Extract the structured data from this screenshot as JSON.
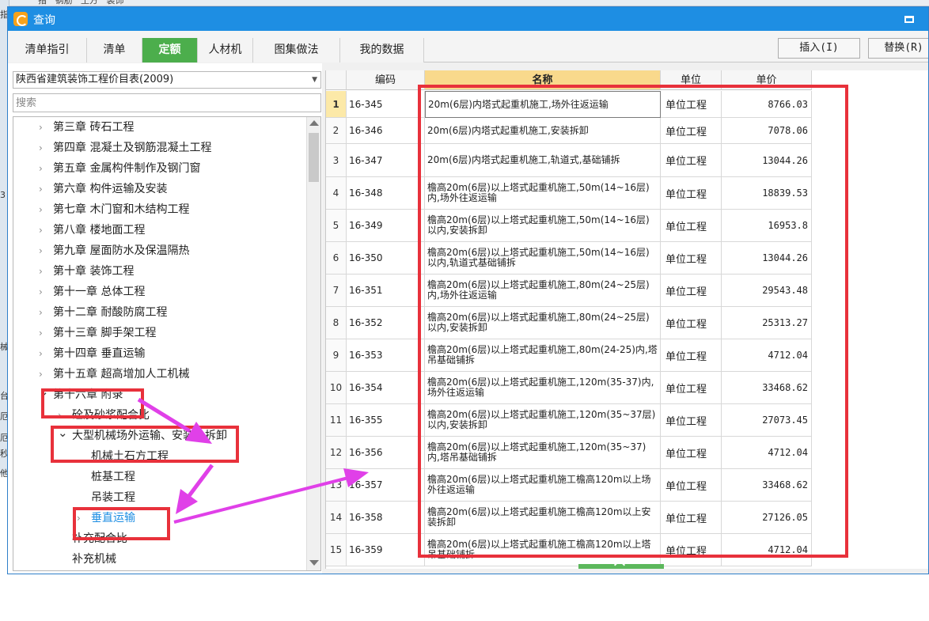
{
  "background": {
    "left_fragments": [
      "指",
      "3",
      "械",
      "台",
      "厄",
      "厄",
      "秒",
      "他"
    ],
    "top_fragment": "指   钢筋   土方   装饰"
  },
  "window": {
    "title": "查询"
  },
  "tabs": [
    {
      "label": "清单指引",
      "active": false
    },
    {
      "label": "清单",
      "active": false
    },
    {
      "label": "定额",
      "active": true
    },
    {
      "label": "人材机",
      "active": false
    },
    {
      "label": "图集做法",
      "active": false
    },
    {
      "label": "我的数据",
      "active": false
    }
  ],
  "buttons": {
    "insert": "插入(I)",
    "replace": "替换(R)"
  },
  "library": {
    "selected": "陕西省建筑装饰工程价目表(2009)"
  },
  "search": {
    "placeholder": "搜索"
  },
  "tree": [
    {
      "label": "第三章 砖石工程",
      "level": 1,
      "toggle": "collapsed"
    },
    {
      "label": "第四章 混凝土及钢筋混凝土工程",
      "level": 1,
      "toggle": "collapsed"
    },
    {
      "label": "第五章 金属构件制作及钢门窗",
      "level": 1,
      "toggle": "collapsed"
    },
    {
      "label": "第六章 构件运输及安装",
      "level": 1,
      "toggle": "collapsed"
    },
    {
      "label": "第七章 木门窗和木结构工程",
      "level": 1,
      "toggle": "collapsed"
    },
    {
      "label": "第八章 楼地面工程",
      "level": 1,
      "toggle": "collapsed"
    },
    {
      "label": "第九章 屋面防水及保温隔热",
      "level": 1,
      "toggle": "collapsed"
    },
    {
      "label": "第十章 装饰工程",
      "level": 1,
      "toggle": "collapsed"
    },
    {
      "label": "第十一章 总体工程",
      "level": 1,
      "toggle": "collapsed"
    },
    {
      "label": "第十二章 耐酸防腐工程",
      "level": 1,
      "toggle": "collapsed"
    },
    {
      "label": "第十三章 脚手架工程",
      "level": 1,
      "toggle": "collapsed"
    },
    {
      "label": "第十四章 垂直运输",
      "level": 1,
      "toggle": "collapsed"
    },
    {
      "label": "第十五章 超高增加人工机械",
      "level": 1,
      "toggle": "collapsed"
    },
    {
      "label": "第十六章 附录",
      "level": 1,
      "toggle": "expanded"
    },
    {
      "label": "砼及砂浆配合比",
      "level": 2,
      "toggle": "collapsed"
    },
    {
      "label": "大型机械场外运输、安装、拆卸",
      "level": 2,
      "toggle": "expanded"
    },
    {
      "label": "机械土石方工程",
      "level": 3,
      "toggle": "none"
    },
    {
      "label": "桩基工程",
      "level": 3,
      "toggle": "none"
    },
    {
      "label": "吊装工程",
      "level": 3,
      "toggle": "none"
    },
    {
      "label": "垂直运输",
      "level": 3,
      "toggle": "collapsed",
      "selected": true
    },
    {
      "label": "补充配合比",
      "level": 2,
      "toggle": "none"
    },
    {
      "label": "补充机械",
      "level": 2,
      "toggle": "none"
    }
  ],
  "table": {
    "columns": [
      "",
      "编码",
      "名称",
      "单位",
      "单价"
    ],
    "rows": [
      {
        "idx": "1",
        "code": "16-345",
        "name": "20m(6层)内塔式起重机施工,场外往返运输",
        "unit": "单位工程",
        "price": "8766.03"
      },
      {
        "idx": "2",
        "code": "16-346",
        "name": "20m(6层)内塔式起重机施工,安装拆卸",
        "unit": "单位工程",
        "price": "7078.06"
      },
      {
        "idx": "3",
        "code": "16-347",
        "name": "20m(6层)内塔式起重机施工,轨道式,基础铺拆",
        "unit": "单位工程",
        "price": "13044.26"
      },
      {
        "idx": "4",
        "code": "16-348",
        "name": "檐高20m(6层)以上塔式起重机施工,50m(14~16层)内,场外往返运输",
        "unit": "单位工程",
        "price": "18839.53"
      },
      {
        "idx": "5",
        "code": "16-349",
        "name": "檐高20m(6层)以上塔式起重机施工,50m(14~16层)以内,安装拆卸",
        "unit": "单位工程",
        "price": "16953.8"
      },
      {
        "idx": "6",
        "code": "16-350",
        "name": "檐高20m(6层)以上塔式起重机施工,50m(14~16层)以内,轨道式基础铺拆",
        "unit": "单位工程",
        "price": "13044.26"
      },
      {
        "idx": "7",
        "code": "16-351",
        "name": "檐高20m(6层)以上塔式起重机施工,80m(24~25层)内,场外往返运输",
        "unit": "单位工程",
        "price": "29543.48"
      },
      {
        "idx": "8",
        "code": "16-352",
        "name": "檐高20m(6层)以上塔式起重机施工,80m(24~25层)以内,安装拆卸",
        "unit": "单位工程",
        "price": "25313.27"
      },
      {
        "idx": "9",
        "code": "16-353",
        "name": "檐高20m(6层)以上塔式起重机施工,80m(24-25)内,塔吊基础铺拆",
        "unit": "单位工程",
        "price": "4712.04"
      },
      {
        "idx": "10",
        "code": "16-354",
        "name": "檐高20m(6层)以上塔式起重机施工,120m(35-37)内,场外往返运输",
        "unit": "单位工程",
        "price": "33468.62"
      },
      {
        "idx": "11",
        "code": "16-355",
        "name": "檐高20m(6层)以上塔式起重机施工,120m(35~37层)以内,安装拆卸",
        "unit": "单位工程",
        "price": "27073.45"
      },
      {
        "idx": "12",
        "code": "16-356",
        "name": "檐高20m(6层)以上塔式起重机施工,120m(35~37)内,塔吊基础铺拆",
        "unit": "单位工程",
        "price": "4712.04"
      },
      {
        "idx": "13",
        "code": "16-357",
        "name": "檐高20m(6层)以上塔式起重机施工檐高120m以上场外往返运输",
        "unit": "单位工程",
        "price": "33468.62"
      },
      {
        "idx": "14",
        "code": "16-358",
        "name": "檐高20m(6层)以上塔式起重机施工檐高120m以上安装拆卸",
        "unit": "单位工程",
        "price": "27126.05"
      },
      {
        "idx": "15",
        "code": "16-359",
        "name": "檐高20m(6层)以上塔式起重机施工檐高120m以上塔吊基础铺拆",
        "unit": "单位工程",
        "price": "4712.04"
      }
    ]
  },
  "annotation_color": "#e8313b",
  "arrow_color": "#e040e8"
}
